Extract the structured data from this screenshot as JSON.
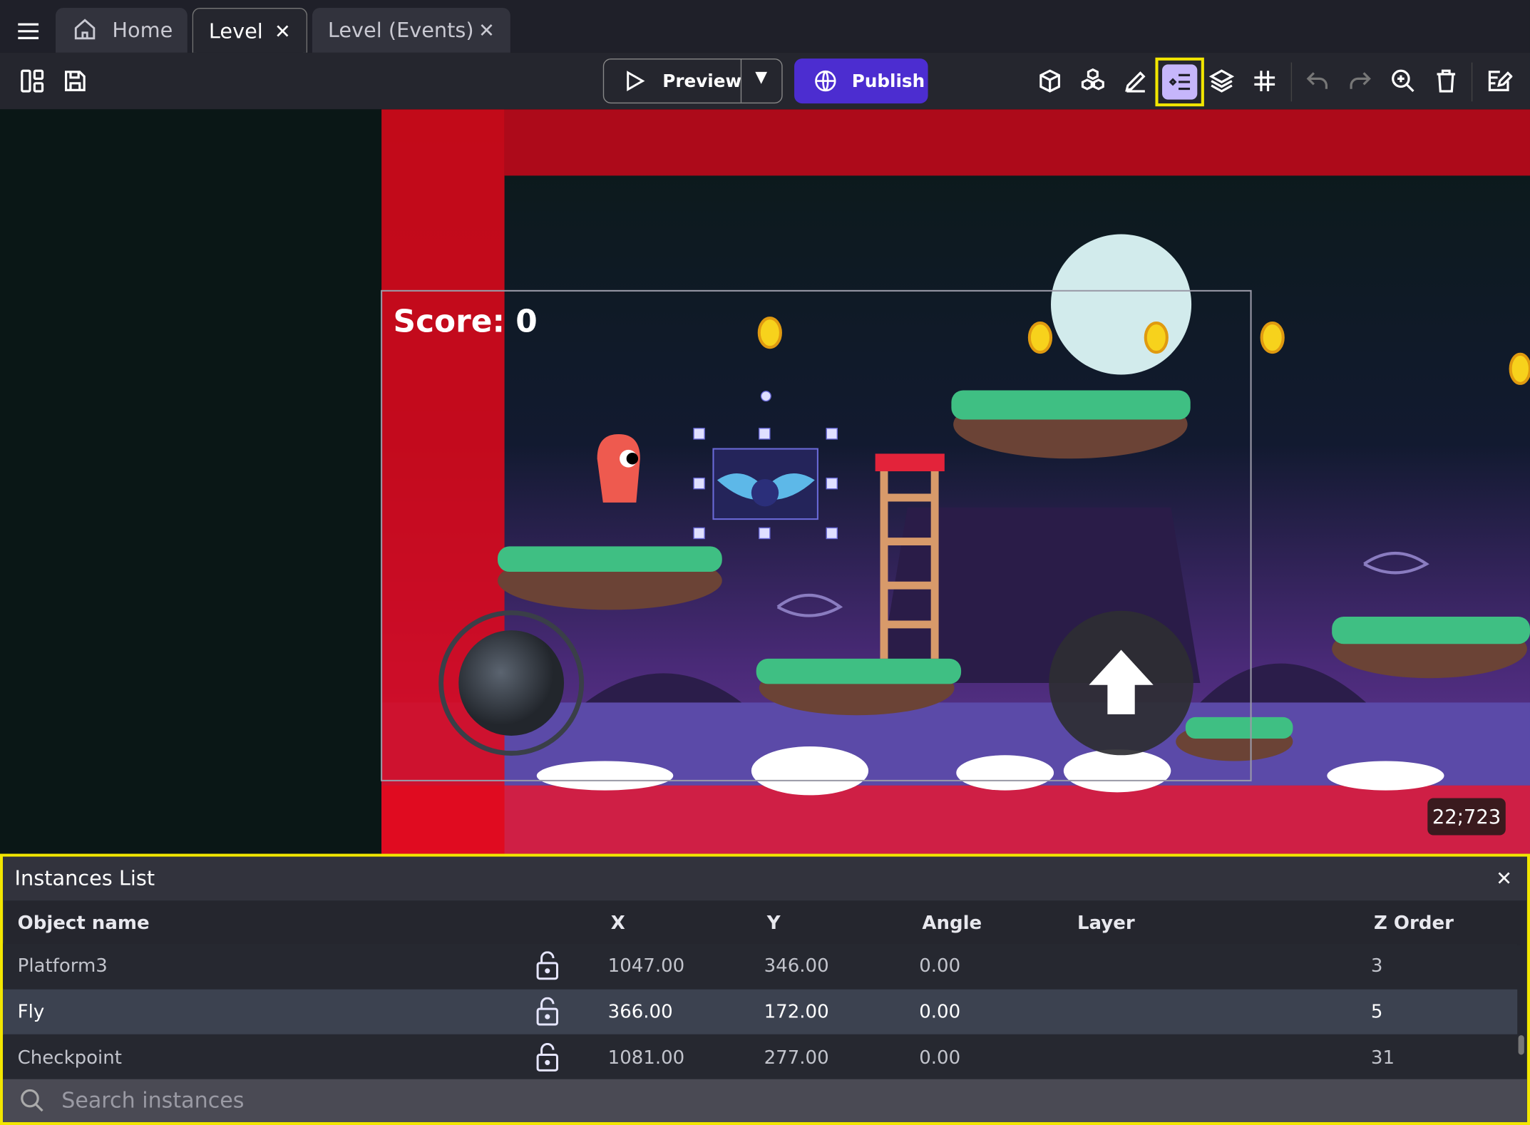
{
  "tabs": [
    {
      "label": "Home",
      "icon": "home-icon"
    },
    {
      "label": "Level",
      "active": true,
      "closable": true
    },
    {
      "label": "Level (Events)",
      "closable": true
    }
  ],
  "toolbar": {
    "preview_label": "Preview",
    "publish_label": "Publish",
    "publish_color": "#4c2dd0",
    "highlight_color": "#f2e600",
    "active_tool": "instances-list-icon"
  },
  "scene": {
    "score_text": "Score: 0",
    "cursor_coords": "22;723"
  },
  "instances_panel": {
    "title": "Instances List",
    "columns": [
      "Object name",
      "X",
      "Y",
      "Angle",
      "Layer",
      "Z Order"
    ],
    "rows": [
      {
        "name": "Platform3",
        "x": "1047.00",
        "y": "346.00",
        "angle": "0.00",
        "layer": "",
        "z": "3",
        "locked": false
      },
      {
        "name": "Fly",
        "x": "366.00",
        "y": "172.00",
        "angle": "0.00",
        "layer": "",
        "z": "5",
        "locked": false,
        "selected": true
      },
      {
        "name": "Checkpoint",
        "x": "1081.00",
        "y": "277.00",
        "angle": "0.00",
        "layer": "",
        "z": "31",
        "locked": false
      }
    ],
    "search_placeholder": "Search instances"
  }
}
